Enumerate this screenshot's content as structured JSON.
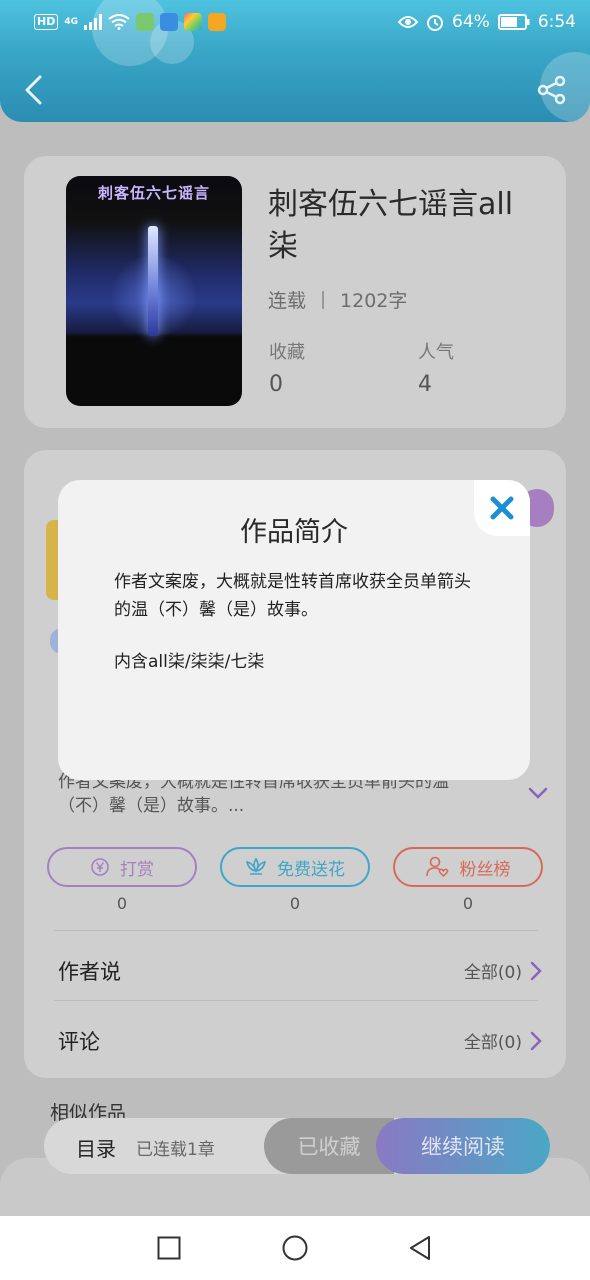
{
  "status_bar": {
    "network_badge": "HD",
    "network_type": "4G",
    "battery_percent": "64%",
    "time": "6:54"
  },
  "book": {
    "cover_title": "刺客伍六七谣言",
    "title": "刺客伍六七谣言all柒",
    "status": "连载",
    "word_count": "1202字",
    "stats": [
      {
        "label": "收藏",
        "value": "0"
      },
      {
        "label": "人气",
        "value": "4"
      }
    ]
  },
  "intro_preview": {
    "line1": "作者文案废，大概就是性转首席收获全员单箭头的温",
    "line2": "（不）馨（是）故事。..."
  },
  "actions": [
    {
      "label": "打赏",
      "count": "0",
      "color": "#a57fc0"
    },
    {
      "label": "免费送花",
      "count": "0",
      "color": "#3fa6c9"
    },
    {
      "label": "粉丝榜",
      "count": "0",
      "color": "#d66a5a"
    }
  ],
  "sections": [
    {
      "label": "作者说",
      "link": "全部(0)"
    },
    {
      "label": "评论",
      "link": "全部(0)"
    }
  ],
  "similar_title": "相似作品",
  "bottom_bar": {
    "toc_label": "目录",
    "toc_sub": "已连载1章",
    "collected_label": "已收藏",
    "read_label": "继续阅读"
  },
  "modal": {
    "title": "作品简介",
    "paragraph1": "作者文案废，大概就是性转首席收获全员单箭头的温（不）馨（是）故事。",
    "paragraph2": "内含all柒/柒柒/七柒"
  },
  "colors": {
    "accent": "#3aa7c7",
    "close_icon": "#1e8fd6"
  }
}
